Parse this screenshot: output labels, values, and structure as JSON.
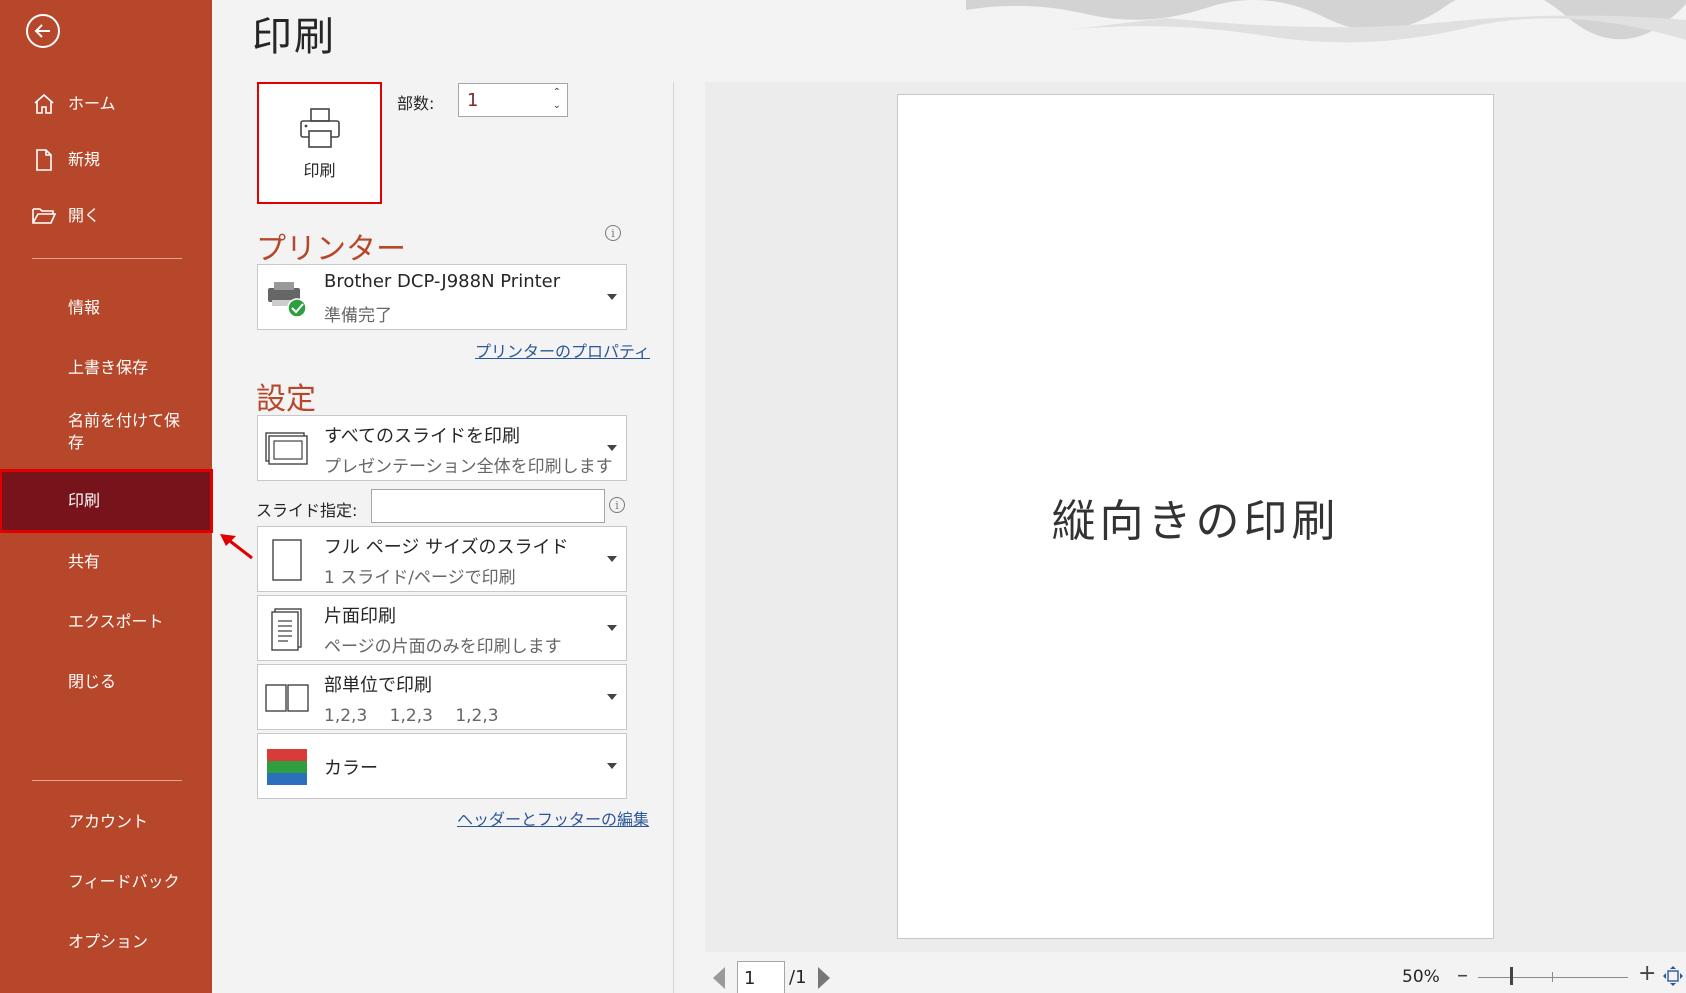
{
  "sidebar": {
    "back_icon": "back-arrow-icon",
    "items": [
      {
        "label": "ホーム",
        "icon": "home-icon"
      },
      {
        "label": "新規",
        "icon": "new-document-icon"
      },
      {
        "label": "開く",
        "icon": "open-folder-icon"
      },
      {
        "label": "情報"
      },
      {
        "label": "上書き保存"
      },
      {
        "label": "名前を付けて保存"
      },
      {
        "label": "印刷",
        "active": true
      },
      {
        "label": "共有"
      },
      {
        "label": "エクスポート"
      },
      {
        "label": "閉じる"
      },
      {
        "label": "アカウント"
      },
      {
        "label": "フィードバック"
      },
      {
        "label": "オプション"
      }
    ]
  },
  "main": {
    "title": "印刷",
    "print_button_label": "印刷",
    "copies_label": "部数:",
    "copies_value": "1",
    "printer_heading": "プリンター",
    "printer": {
      "name": "Brother DCP-J988N Printer",
      "status": "準備完了",
      "properties_link": "プリンターのプロパティ"
    },
    "settings_heading": "設定",
    "settings": {
      "slides_range": {
        "title": "すべてのスライドを印刷",
        "subtitle": "プレゼンテーション全体を印刷します"
      },
      "slides_label": "スライド指定:",
      "slides_value": "",
      "layout": {
        "title": "フル ページ サイズのスライド",
        "subtitle": "1 スライド/ページで印刷"
      },
      "sides": {
        "title": "片面印刷",
        "subtitle": "ページの片面のみを印刷します"
      },
      "collate": {
        "title": "部単位で印刷",
        "subtitle": "1,2,3　 1,2,3　 1,2,3"
      },
      "color": {
        "title": "カラー"
      },
      "header_footer_link": "ヘッダーとフッターの編集"
    }
  },
  "preview": {
    "slide_text": "縦向きの印刷",
    "current_page": "1",
    "total_pages": "/1",
    "zoom": "50%",
    "zoom_level_fraction": 0.22
  },
  "colors": {
    "sidebar": "#b7472a",
    "active_item": "#77131b",
    "highlight": "#e00000",
    "accent_heading": "#b7472a",
    "link": "#2b579a"
  }
}
